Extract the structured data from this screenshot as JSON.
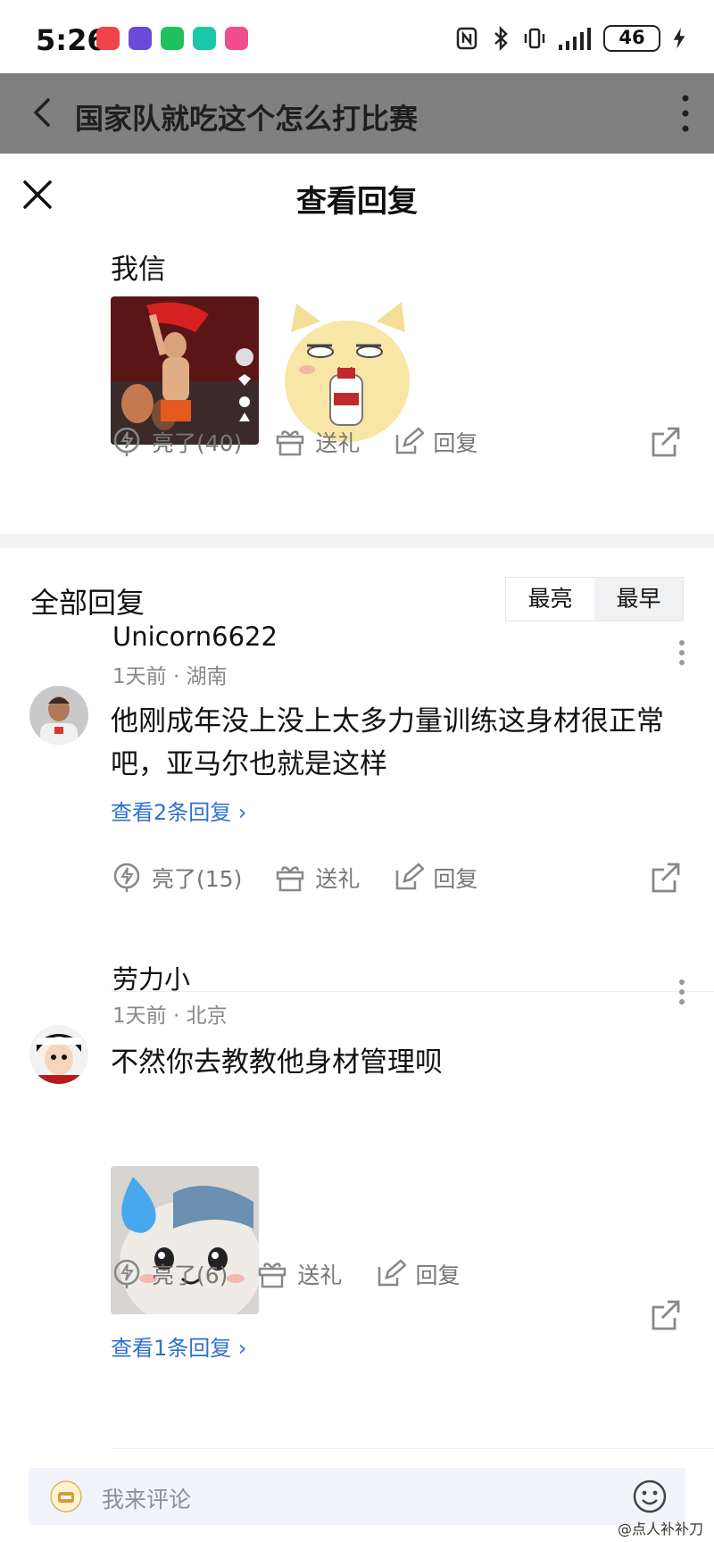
{
  "status": {
    "time": "5:26",
    "battery": "46"
  },
  "page_header": {
    "title": "国家队就吃这个怎么打比赛"
  },
  "sheet": {
    "title": "查看回复"
  },
  "original": {
    "text": "我信",
    "actions": {
      "like": "亮了(40)",
      "gift": "送礼",
      "reply": "回复"
    }
  },
  "replies_section": {
    "title": "全部回复",
    "sort_options": [
      "最亮",
      "最早"
    ],
    "active_sort": "最早"
  },
  "comments": [
    {
      "user": "Unicorn6622",
      "time": "1天前",
      "location": "湖南",
      "text": "他刚成年没上没上太多力量训练这身材很正常吧，亚马尔也就是这样",
      "view_replies": "查看2条回复",
      "actions": {
        "like": "亮了(15)",
        "gift": "送礼",
        "reply": "回复"
      }
    },
    {
      "user": "劳力小",
      "time": "1天前",
      "location": "北京",
      "text": "不然你去教教他身材管理呗",
      "view_replies": "查看1条回复",
      "actions": {
        "like": "亮了(6)",
        "gift": "送礼",
        "reply": "回复"
      }
    }
  ],
  "composer": {
    "placeholder": "我来评论"
  },
  "watermark": "@点人补补刀",
  "colors": {
    "link": "#2e6fd1",
    "meta": "#888888",
    "dim": "#808080"
  }
}
